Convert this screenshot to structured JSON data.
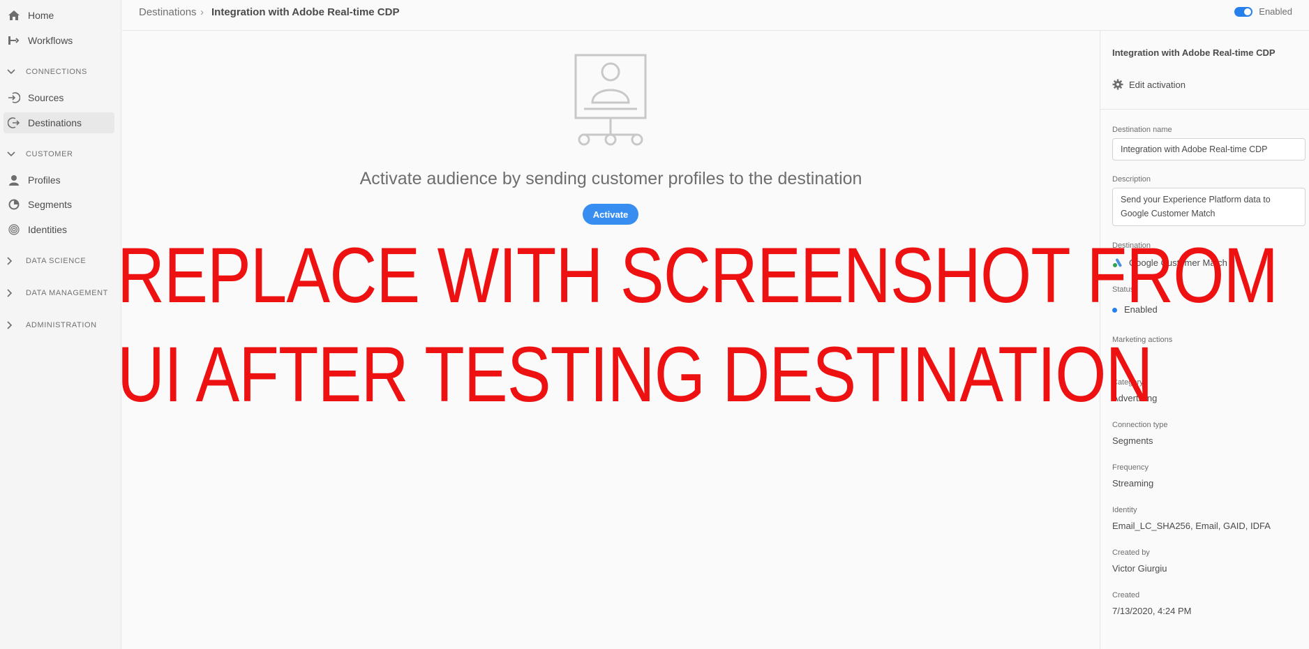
{
  "sidebar": {
    "items": [
      {
        "label": "Home",
        "icon": "home-icon"
      },
      {
        "label": "Workflows",
        "icon": "workflows-icon"
      }
    ],
    "sections": {
      "connections": "CONNECTIONS",
      "customer": "CUSTOMER",
      "data_science": "DATA SCIENCE",
      "data_management": "DATA MANAGEMENT",
      "administration": "ADMINISTRATION"
    },
    "connections_items": [
      {
        "label": "Sources",
        "icon": "sources-icon"
      },
      {
        "label": "Destinations",
        "icon": "destinations-icon",
        "active": true
      }
    ],
    "customer_items": [
      {
        "label": "Profiles",
        "icon": "profiles-icon"
      },
      {
        "label": "Segments",
        "icon": "segments-icon"
      },
      {
        "label": "Identities",
        "icon": "identities-icon"
      }
    ]
  },
  "topbar": {
    "breadcrumb_root": "Destinations",
    "breadcrumb_sep": "›",
    "breadcrumb_current": "Integration with Adobe Real-time CDP",
    "toggle_label": "Enabled",
    "toggle_on": true
  },
  "main": {
    "activate_text": "Activate audience by sending customer profiles to the destination",
    "activate_button": "Activate",
    "illustration_icon": "profile-board-icon"
  },
  "overlay": {
    "line1": "REPLACE WITH SCREENSHOT FROM",
    "line2": "UI AFTER TESTING DESTINATION"
  },
  "panel": {
    "title": "Integration with Adobe Real-time CDP",
    "edit_label": "Edit activation",
    "destination_name_label": "Destination name",
    "destination_name_value": "Integration with Adobe Real-time CDP",
    "description_label": "Description",
    "description_value": "Send your Experience Platform data to Google Customer Match",
    "destination_label": "Destination",
    "destination_value": "Google Customer Match",
    "status_label": "Status",
    "status_value": "Enabled",
    "marketing_label": "Marketing actions",
    "marketing_value": "-",
    "category_label": "Category",
    "category_value": "Advertising",
    "connection_type_label": "Connection type",
    "connection_type_value": "Segments",
    "frequency_label": "Frequency",
    "frequency_value": "Streaming",
    "identity_label": "Identity",
    "identity_value": "Email_LC_SHA256, Email, GAID, IDFA",
    "created_by_label": "Created by",
    "created_by_value": "Victor Giurgiu",
    "created_label": "Created",
    "created_value": "7/13/2020, 4:24 PM"
  },
  "colors": {
    "accent": "#2680eb",
    "overlay_red": "#ee1111"
  }
}
